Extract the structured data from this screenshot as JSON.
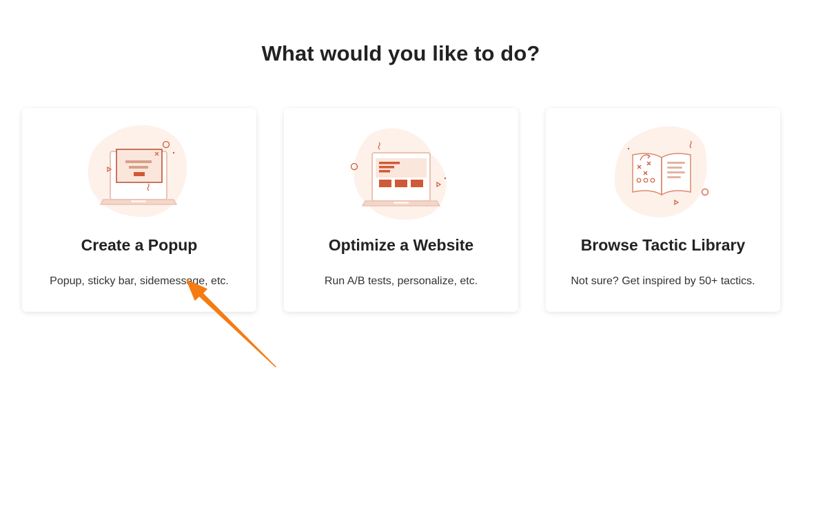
{
  "heading": "What would you like to do?",
  "colors": {
    "accent": "#cf5a37",
    "blob": "#fdf1ea",
    "line": "#d98a6e",
    "annotation_arrow": "#f47c13"
  },
  "cards": [
    {
      "title": "Create a Popup",
      "description": "Popup, sticky bar, sidemessage, etc.",
      "icon": "laptop-popup-illustration"
    },
    {
      "title": "Optimize a Website",
      "description": "Run A/B tests, personalize, etc.",
      "icon": "laptop-website-illustration"
    },
    {
      "title": "Browse Tactic Library",
      "description": "Not sure? Get inspired by 50+ tactics.",
      "icon": "playbook-illustration"
    }
  ],
  "annotation": {
    "type": "arrow",
    "target": "Create a Popup card description"
  }
}
